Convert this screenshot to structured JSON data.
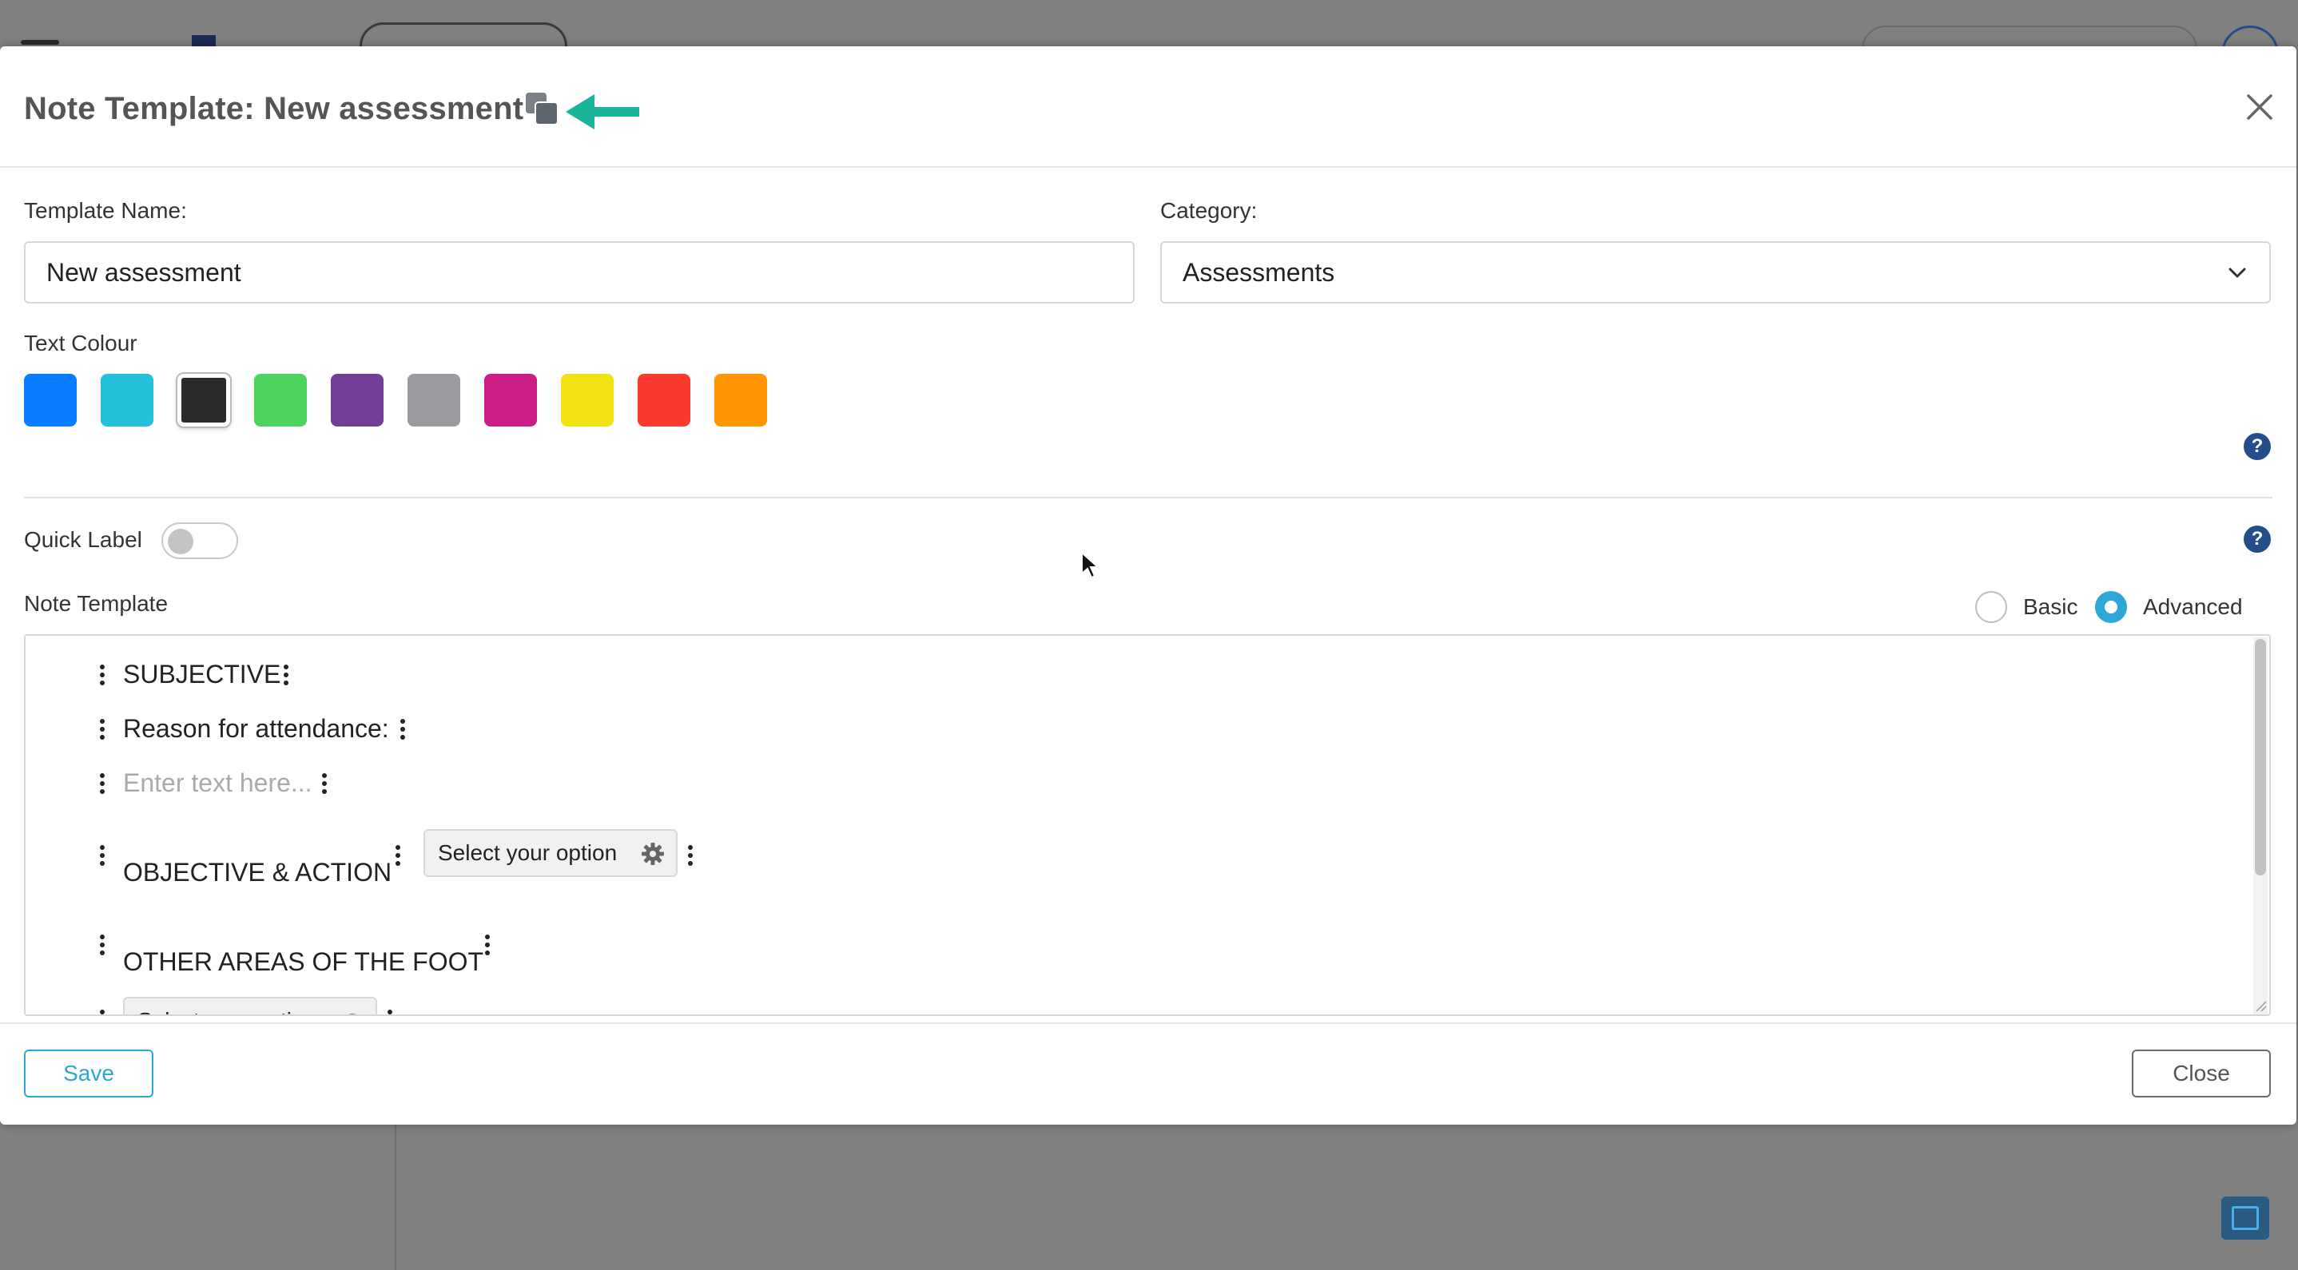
{
  "modal": {
    "title": "Note Template: New assessment",
    "close_icon": "close-icon",
    "copy_icon": "copy-icon",
    "annotation_arrow": "arrow-left-icon"
  },
  "form": {
    "template_name_label": "Template Name:",
    "template_name_value": "New assessment",
    "category_label": "Category:",
    "category_value": "Assessments",
    "text_colour_label": "Text Colour",
    "colours": [
      "#0a7cff",
      "#24c0da",
      "#2b2b2b",
      "#4cd360",
      "#743e97",
      "#9b9b9f",
      "#cc1c85",
      "#f1e213",
      "#fb3a2f",
      "#ff9500"
    ],
    "selected_colour": "#2b2b2b",
    "quick_label": "Quick Label",
    "quick_label_on": false,
    "note_template_label": "Note Template",
    "mode_basic": "Basic",
    "mode_advanced": "Advanced",
    "mode_selected": "Advanced"
  },
  "editor": {
    "rows": [
      {
        "text": "SUBJECTIVE"
      },
      {
        "text": "Reason for attendance:"
      },
      {
        "placeholder": "Enter text here..."
      },
      {
        "text": "OBJECTIVE & ACTION",
        "select": "Select your option"
      },
      {
        "text": "OTHER AREAS OF THE FOOT"
      },
      {
        "select": "Select your option"
      }
    ]
  },
  "footer": {
    "save_label": "Save",
    "close_label": "Close"
  }
}
